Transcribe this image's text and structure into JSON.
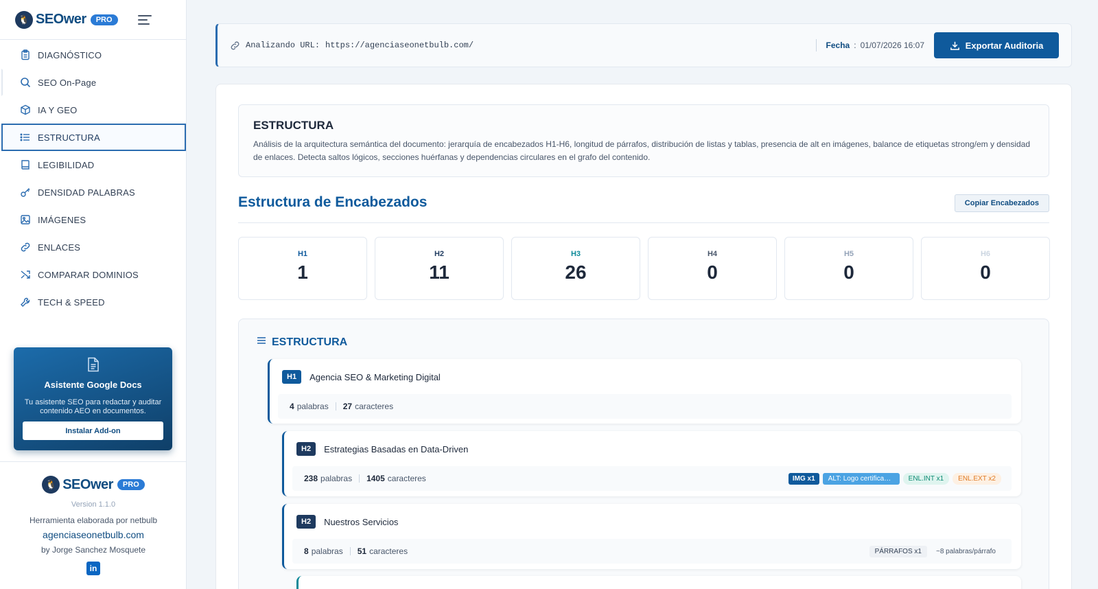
{
  "brand": {
    "name": "SEOwer",
    "badge": "PRO"
  },
  "nav": [
    {
      "label": "DIAGNÓSTICO",
      "icon": "clipboard-icon"
    },
    {
      "label": "SEO On-Page",
      "icon": "search-icon"
    },
    {
      "label": "IA Y GEO",
      "icon": "cube-icon"
    },
    {
      "label": "ESTRUCTURA",
      "icon": "list-icon",
      "active": true
    },
    {
      "label": "LEGIBILIDAD",
      "icon": "book-icon"
    },
    {
      "label": "DENSIDAD PALABRAS",
      "icon": "key-icon"
    },
    {
      "label": "IMÁGENES",
      "icon": "image-icon"
    },
    {
      "label": "ENLACES",
      "icon": "link-icon"
    },
    {
      "label": "COMPARAR DOMINIOS",
      "icon": "shuffle-icon"
    },
    {
      "label": "TECH & SPEED",
      "icon": "wrench-icon"
    }
  ],
  "promo": {
    "title": "Asistente Google Docs",
    "description": "Tu asistente SEO para redactar y auditar contenido AEO en documentos.",
    "button": "Instalar Add-on"
  },
  "footer": {
    "version": "Version 1.1.0",
    "credit": "Herramienta elaborada por netbulb",
    "site": "agenciaseonetbulb.com",
    "author": "by Jorge Sanchez Mosquete"
  },
  "url_bar": {
    "label": "Analizando URL:",
    "url": "https://agenciaseonetbulb.com/",
    "date_label": "Fecha",
    "date_value": "01/07/2026 16:07",
    "export_label": "Exportar Auditoria"
  },
  "intro": {
    "title": "ESTRUCTURA",
    "description": "Análisis de la arquitectura semántica del documento: jerarquía de encabezados H1-H6, longitud de párrafos, distribución de listas y tablas, presencia de alt en imágenes, balance de etiquetas strong/em y densidad de enlaces. Detecta saltos lógicos, secciones huérfanas y dependencias circulares en el grafo del contenido."
  },
  "headings": {
    "title": "Estructura de Encabezados",
    "copy_label": "Copiar Encabezados",
    "stats": [
      {
        "label": "H1",
        "value": "1",
        "color": "#0f5a9c"
      },
      {
        "label": "H2",
        "value": "11",
        "color": "#1e3a5f"
      },
      {
        "label": "H3",
        "value": "26",
        "color": "#0d8a99"
      },
      {
        "label": "H4",
        "value": "0",
        "color": "#475569"
      },
      {
        "label": "H5",
        "value": "0",
        "color": "#94a3b8"
      },
      {
        "label": "H6",
        "value": "0",
        "color": "#cbd5e1"
      }
    ]
  },
  "tree": {
    "title": "ESTRUCTURA",
    "words_label": "palabras",
    "chars_label": "caracteres",
    "nodes": [
      {
        "tag": "H1",
        "text": "Agencia SEO & Marketing Digital",
        "words": "4",
        "chars": "27"
      },
      {
        "tag": "H2",
        "text": "Estrategias Basadas en Data-Driven",
        "words": "238",
        "chars": "1405",
        "pills": {
          "img": "IMG x1",
          "alt": "ALT: Logo certificado g...",
          "int": "ENL.INT x1",
          "ext": "ENL.EXT x2"
        }
      },
      {
        "tag": "H2",
        "text": "Nuestros Servicios",
        "words": "8",
        "chars": "51",
        "pills": {
          "par": "PÁRRAFOS x1",
          "avg": "~8 palabras/párrafo"
        }
      }
    ]
  }
}
